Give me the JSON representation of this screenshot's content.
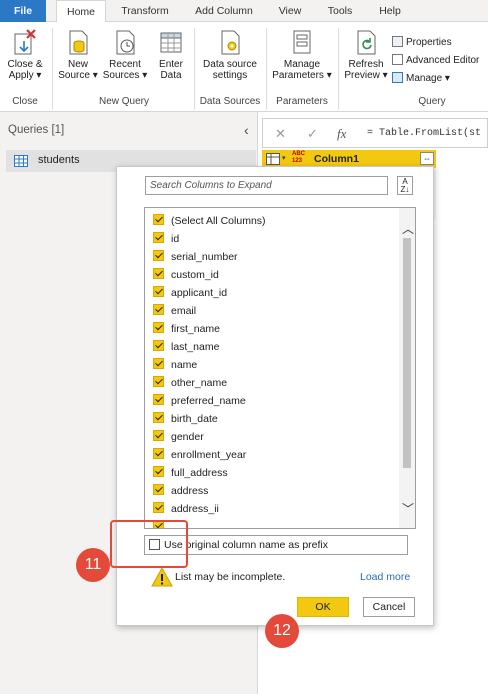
{
  "ribbon_tabs": [
    "File",
    "Home",
    "Transform",
    "Add Column",
    "View",
    "Tools",
    "Help"
  ],
  "ribbon": {
    "close_apply": {
      "line1": "Close &",
      "line2": "Apply ▾"
    },
    "new_source": {
      "line1": "New",
      "line2": "Source ▾"
    },
    "recent_sources": {
      "line1": "Recent",
      "line2": "Sources ▾"
    },
    "enter_data": {
      "line1": "Enter",
      "line2": "Data"
    },
    "data_source_settings": {
      "line1": "Data source",
      "line2": "settings"
    },
    "manage_parameters": {
      "line1": "Manage",
      "line2": "Parameters ▾"
    },
    "refresh_preview": {
      "line1": "Refresh",
      "line2": "Preview ▾"
    },
    "properties": "Properties",
    "advanced_editor": "Advanced Editor",
    "manage": "Manage ▾",
    "groups": {
      "close": "Close",
      "new_query": "New Query",
      "data_sources": "Data Sources",
      "parameters": "Parameters",
      "query": "Query"
    }
  },
  "queries": {
    "title": "Queries [1]",
    "collapse": "‹",
    "items": [
      "students"
    ]
  },
  "formula_bar": {
    "formula": "= Table.FromList(st"
  },
  "column_header": {
    "type_top": "ABC",
    "type_bottom": "123",
    "name": "Column1"
  },
  "expand_popup": {
    "search_placeholder": "Search Columns to Expand",
    "columns": [
      "(Select All Columns)",
      "id",
      "serial_number",
      "custom_id",
      "applicant_id",
      "email",
      "first_name",
      "last_name",
      "name",
      "other_name",
      "preferred_name",
      "birth_date",
      "gender",
      "enrollment_year",
      "full_address",
      "address",
      "address_ii"
    ],
    "prefix_label": "Use original column name as prefix",
    "warning": "List may be incomplete.",
    "load_more": "Load more",
    "ok": "OK",
    "cancel": "Cancel"
  },
  "annotations": {
    "step_11": "11",
    "step_12": "12"
  },
  "colors": {
    "accent": "#f2c811",
    "file_tab": "#2b78c4",
    "annotation": "#e34a3a"
  }
}
